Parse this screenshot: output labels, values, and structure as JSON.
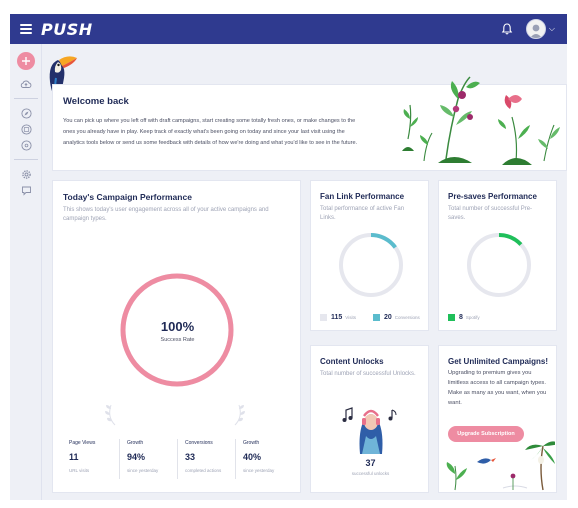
{
  "app": {
    "brand": "PUSH"
  },
  "icons": {
    "menu": "hamburger-icon",
    "notifications": "bell-icon",
    "profile": "avatar",
    "sidebar": [
      "add-icon",
      "upload-cloud-icon",
      "compass-icon",
      "image-icon",
      "disc-icon",
      "settings-icon",
      "chat-icon"
    ]
  },
  "welcome": {
    "title": "Welcome back",
    "body": "You can pick up where you left off with draft campaigns, start creating some totally fresh ones, or make changes to the ones you already have in play. Keep track of exactly what's been going on today and since your last visit using the analytics tools below or send us some feedback with details of how we're doing and what you'd like to see in the future."
  },
  "today": {
    "title": "Today's Campaign Performance",
    "subtitle": "This shows today's user engagement across all of your active campaigns and campaign types.",
    "success_rate_value": "100%",
    "success_rate_label": "Success Rate",
    "success_rate": 1.0,
    "stats": [
      {
        "label": "Page Views",
        "value": "11",
        "foot": "URL visits"
      },
      {
        "label": "Growth",
        "value": "94%",
        "foot": "since yesterday"
      },
      {
        "label": "Conversions",
        "value": "33",
        "foot": "completed actions"
      },
      {
        "label": "Growth",
        "value": "40%",
        "foot": "since yesterday"
      }
    ]
  },
  "fan_link": {
    "title": "Fan Link Performance",
    "subtitle": "Total performance of active Fan Links.",
    "visits_value": "115",
    "visits_label": "Visits",
    "conversions_value": "20",
    "conversions_label": "Conversions",
    "ring_fill": 0.15
  },
  "presaves": {
    "title": "Pre-saves Performance",
    "subtitle": "Total number of successful Pre-saves.",
    "spotify_value": "8",
    "spotify_label": "Spotify",
    "ring_fill": 0.13
  },
  "unlocks": {
    "title": "Content Unlocks",
    "subtitle": "Total number of successful Unlocks.",
    "value": "37",
    "foot": "successful unlocks"
  },
  "unlimited": {
    "title": "Get Unlimited Campaigns!",
    "body": "Upgrading to premium gives you limitless access to all campaign types. Make as many as you want, when you want.",
    "button": "Upgrade Subscription"
  },
  "colors": {
    "nav": "#2f3a8f",
    "accent_pink": "#ee8ca2",
    "fan_link_teal": "#5bbccd",
    "spotify_green": "#1fbf5a",
    "ring_track": "#e6e7ee"
  }
}
